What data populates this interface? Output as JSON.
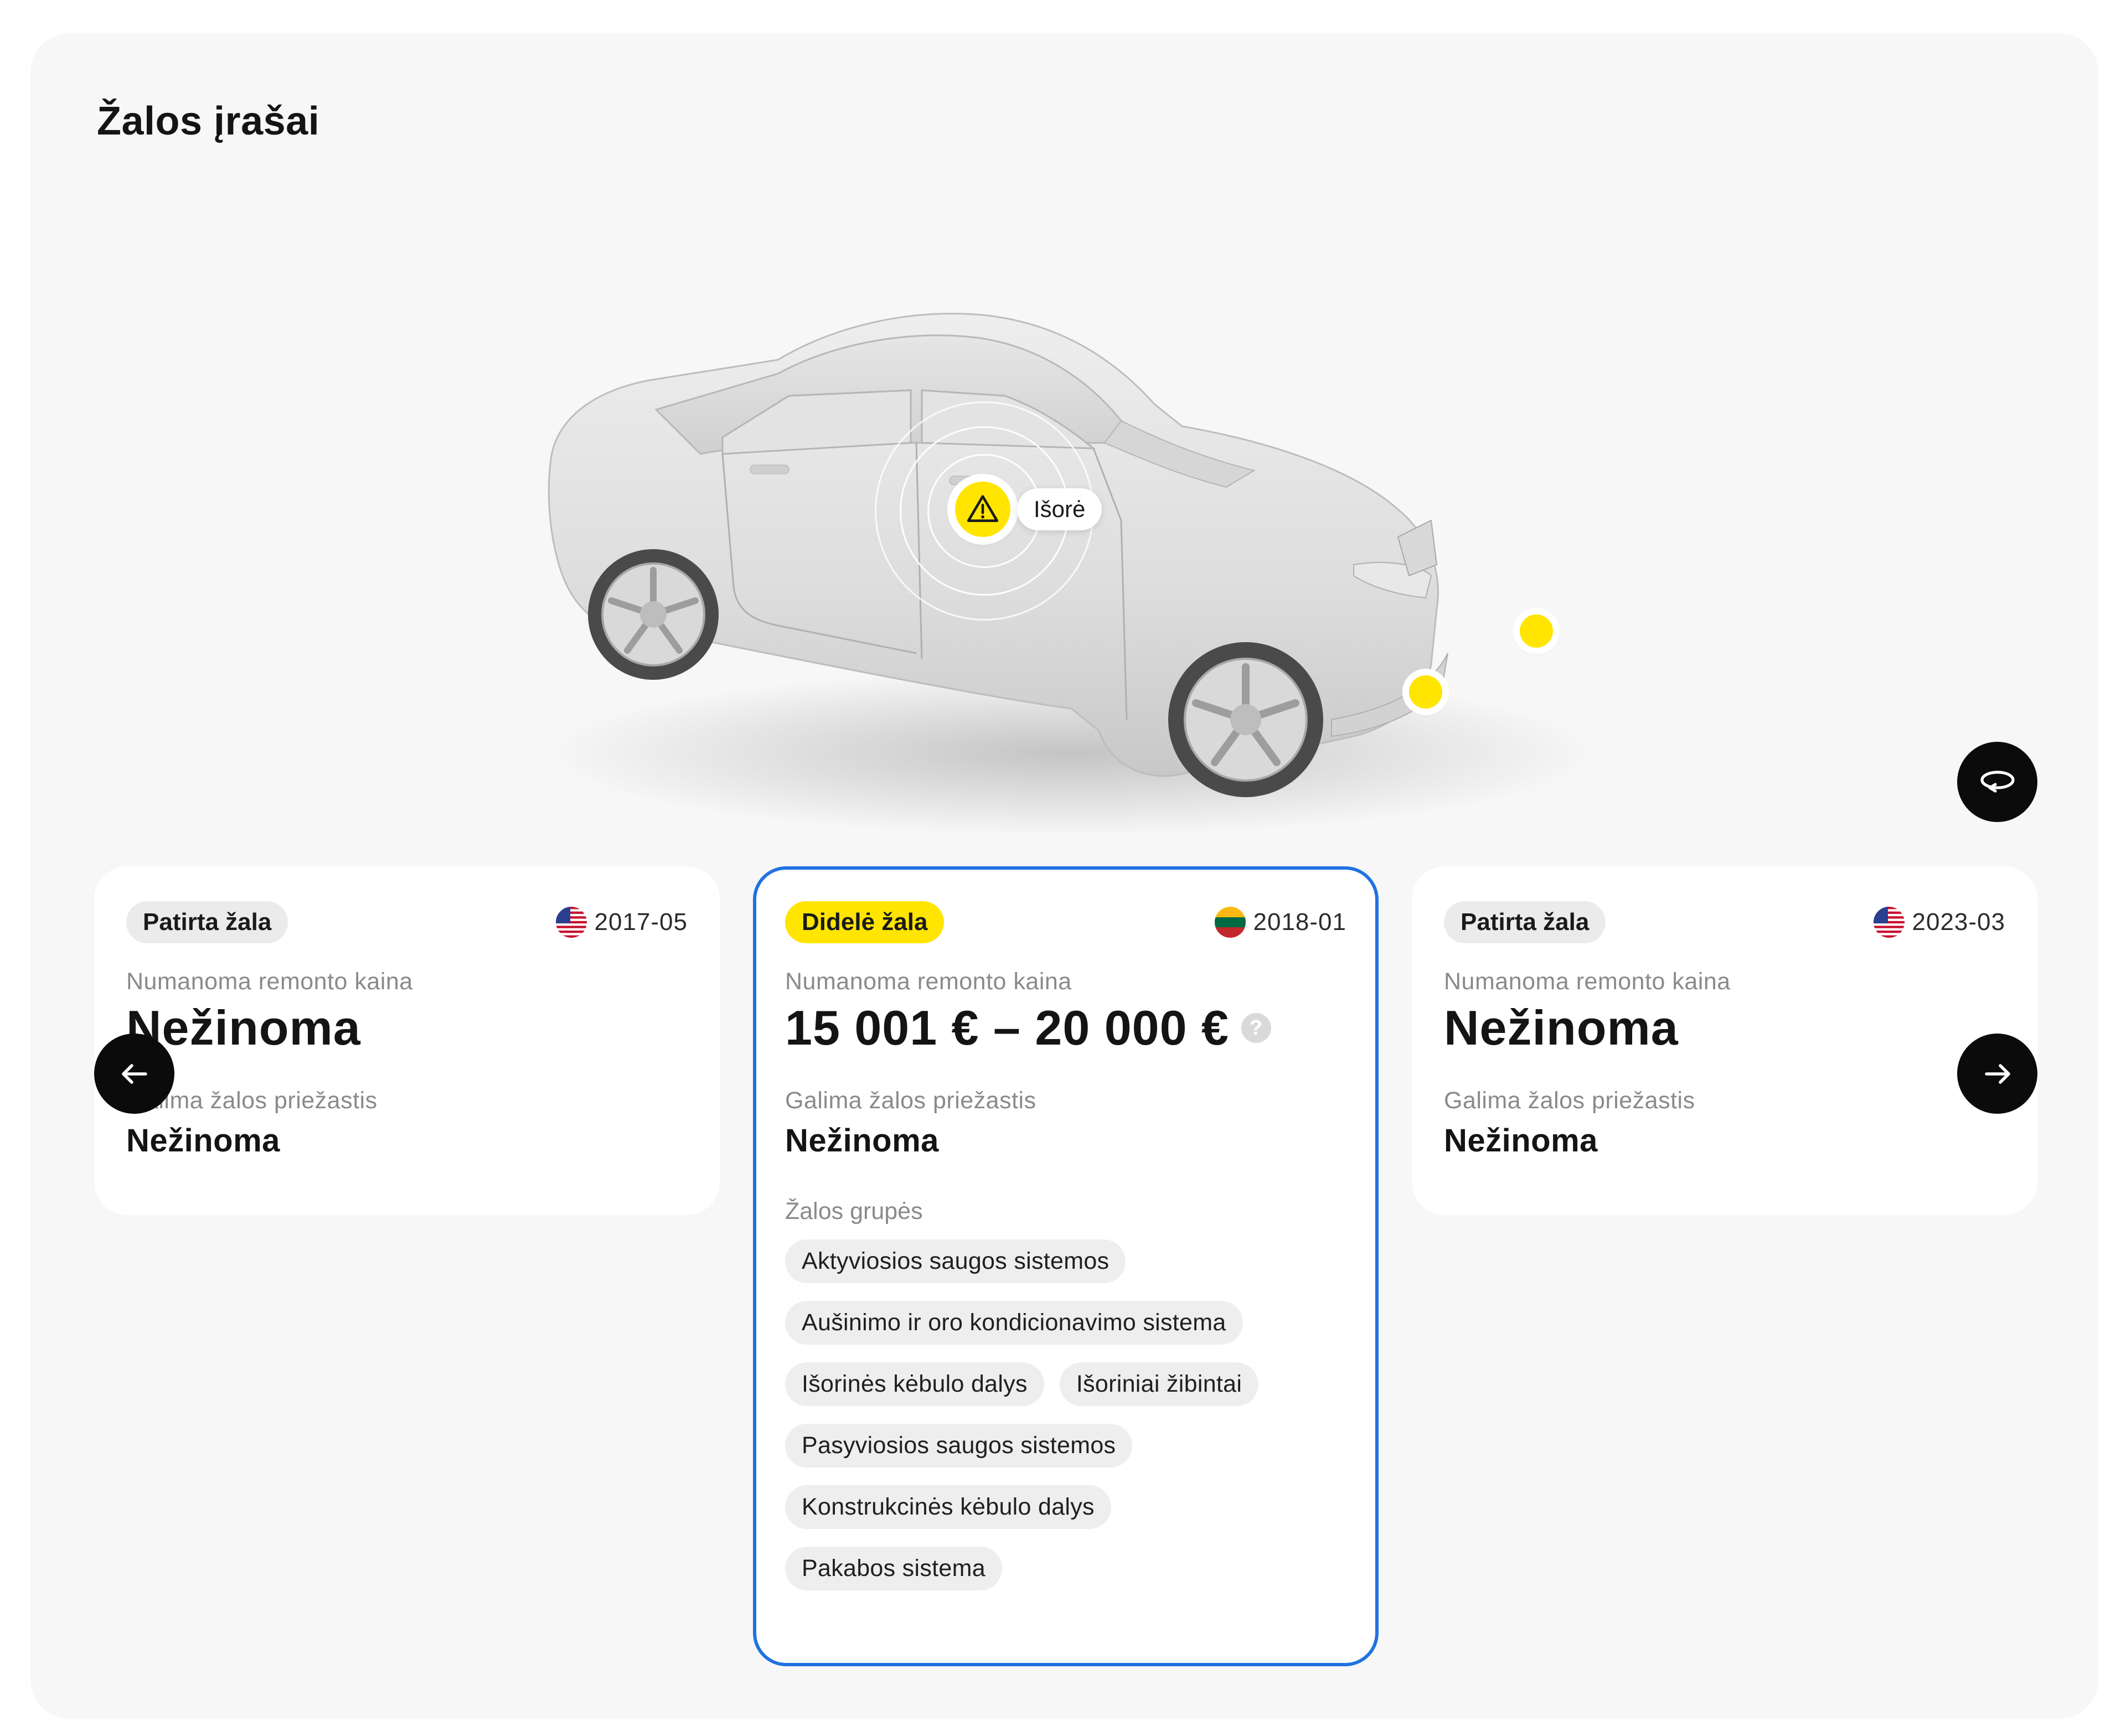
{
  "section_title": "Žalos įrašai",
  "car_view": {
    "marker_label": "Išorė",
    "marker_icon": "warning-icon",
    "marker_color": "#ffe500"
  },
  "controls": {
    "rotate_icon": "rotate-icon",
    "prev_icon": "arrow-left-icon",
    "next_icon": "arrow-right-icon"
  },
  "cards": [
    {
      "tag": "Patirta žala",
      "country": "US",
      "date": "2017-05",
      "cost_label": "Numanoma remonto kaina",
      "cost_value": "Nežinoma",
      "cause_label": "Galima žalos priežastis",
      "cause_value": "Nežinoma"
    },
    {
      "tag": "Didelė žala",
      "country": "LT",
      "date": "2018-01",
      "cost_label": "Numanoma remonto kaina",
      "cost_value": "15 001 € – 20 000 €",
      "help_icon": "?",
      "cause_label": "Galima žalos priežastis",
      "cause_value": "Nežinoma",
      "groups_label": "Žalos grupės",
      "groups": [
        "Aktyviosios saugos sistemos",
        "Aušinimo ir oro kondicionavimo sistema",
        "Išorinės kėbulo dalys",
        "Išoriniai žibintai",
        "Pasyviosios saugos sistemos",
        "Konstrukcinės kėbulo dalys",
        "Pakabos sistema"
      ]
    },
    {
      "tag": "Patirta žala",
      "country": "US",
      "date": "2023-03",
      "cost_label": "Numanoma remonto kaina",
      "cost_value": "Nežinoma",
      "cause_label": "Galima žalos priežastis",
      "cause_value": "Nežinoma"
    }
  ],
  "colors": {
    "selected_border": "#1f73e0",
    "major_tag": "#ffe500",
    "button_bg": "#0b0b0b"
  }
}
